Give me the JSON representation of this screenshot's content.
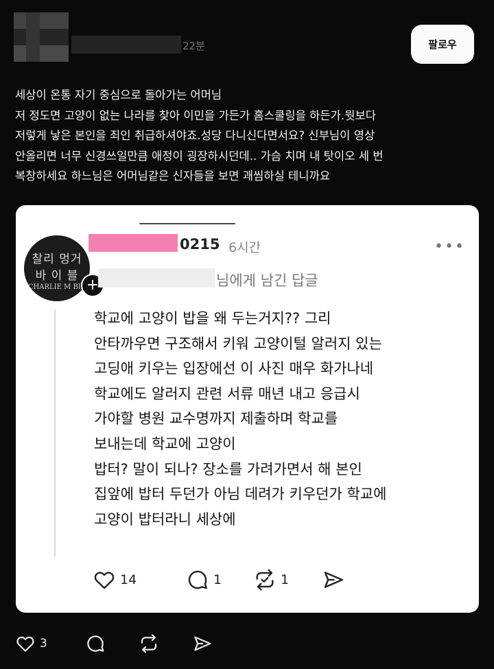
{
  "post": {
    "time_partial": "22분",
    "follow_label": "팔로우",
    "lines": [
      "세상이 온통 자기 중심으로 돌아가는 어머님",
      "저 정도면 고양이 없는 나라를 찾아 이민을 가든가 홈스쿨링을 하든가.뭣보다",
      "저렇게 낳은 본인을 죄인 취급하셔야죠.성당 다니신다면서요? 신부님이 영상",
      "안올리면 너무 신경쓰일만큼 애정이 굉장하시던데.. 가슴 치며 내 탓이오 세 번",
      "복창하세요 하느님은 어머님같은 신자들을 보면 괘씸하실 테니까요"
    ],
    "actions": {
      "like_count": "3"
    }
  },
  "quoted": {
    "avatar_text": {
      "line1": "찰리 멍거",
      "line2": "바 이 블",
      "line3": "CHARLIE M  BIB"
    },
    "username_suffix": "0215",
    "time": "6시간",
    "more": "•••",
    "reply_to": "님에게 남긴 답글",
    "body": [
      "학교에 고양이 밥을 왜 두는거지?? 그리",
      "안타까우면 구조해서 키워 고양이털 알러지 있는",
      "고딩애 키우는 입장에선 이 사진 매우 화가나네",
      "학교에도 알러지 관련 서류 매년 내고 응급시",
      "가야할 병원 교수명까지 제출하며 학교를",
      "보내는데 학교에 고양이",
      "밥터? 말이 되나? 장소를 가려가면서 해 본인",
      "집앞에 밥터 두던가 아님 데려가 키우던가 학교에",
      "고양이 밥터라니 세상에"
    ],
    "actions": {
      "like_count": "14",
      "comment_count": "1",
      "repost_count": "1"
    }
  }
}
